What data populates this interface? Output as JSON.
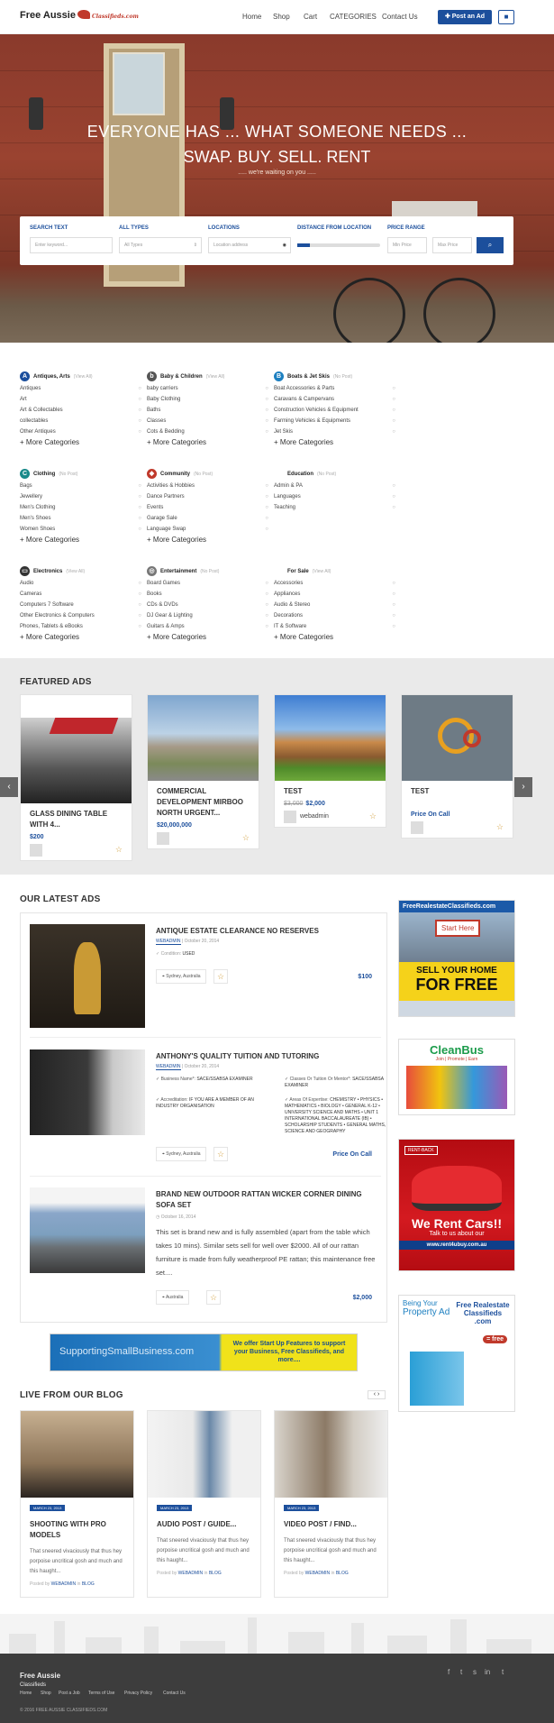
{
  "header": {
    "logo_text": "Free Aussie",
    "logo_sub": "Classifieds.com",
    "nav": [
      "Home",
      "Shop",
      "Cart",
      "CATEGORIES",
      "Contact Us"
    ],
    "post_button": "✚ Post an Ad",
    "user_icon": "user-icon"
  },
  "hero": {
    "line1": "EVERYONE HAS ... WHAT SOMEONE NEEDS ...",
    "line2": "SWAP. BUY. SELL. RENT",
    "line3": "..... we're waiting on you ....."
  },
  "search": {
    "labels": [
      "SEARCH TEXT",
      "ALL TYPES",
      "LOCATIONS",
      "DISTANCE FROM LOCATION",
      "PRICE RANGE"
    ],
    "keyword_placeholder": "Enter keyword...",
    "types_value": "All Types",
    "location_placeholder": "Location address",
    "min_price": "Min Price",
    "max_price": "Max Price",
    "button_icon": "search-icon"
  },
  "categories": [
    {
      "name": "Antiques, Arts",
      "count": "(View All)",
      "color": "#1c4f9c",
      "icon": "A",
      "items": [
        "Antiques",
        "Art",
        "Art & Collectables",
        "collectables",
        "Other Antiques"
      ],
      "more": "More Categories"
    },
    {
      "name": "Baby & Children",
      "count": "(View All)",
      "color": "#555555",
      "icon": "b",
      "items": [
        "baby carriers",
        "Baby Clothing",
        "Baths",
        "Classes",
        "Cots & Bedding"
      ],
      "more": "More Categories"
    },
    {
      "name": "Boats & Jet Skis",
      "count": "(No Post)",
      "color": "#1c7fc0",
      "icon": "B",
      "items": [
        "Boat Accessories & Parts",
        "Caravans & Campervans",
        "Construction Vehicles & Equipment",
        "Farming Vehicles & Equipments",
        "Jet Skis"
      ],
      "more": "More Categories"
    },
    {
      "name": "Clothing",
      "count": "(No Post)",
      "color": "#1a8a8a",
      "icon": "C",
      "items": [
        "Bags",
        "Jewellery",
        "Men's Clothing",
        "Men's Shoes",
        "Women Shoes"
      ],
      "more": "More Categories"
    },
    {
      "name": "Community",
      "count": "(No Post)",
      "color": "#c0392b",
      "icon": "◆",
      "items": [
        "Activities & Hobbies",
        "Dance Partners",
        "Events",
        "Garage Sale",
        "Language Swap"
      ],
      "more": "More Categories"
    },
    {
      "name": "Education",
      "count": "(No Post)",
      "color": "#ffffff",
      "icon": "",
      "items": [
        "Admin & PA",
        "Languages",
        "Teaching"
      ],
      "more": ""
    },
    {
      "name": "Electronics",
      "count": "(View All)",
      "color": "#333333",
      "icon": "▭",
      "items": [
        "Audio",
        "Cameras",
        "Computers 7 Software",
        "Other Electronics & Computers",
        "Phones, Tablets & eBooks"
      ],
      "more": "More Categories"
    },
    {
      "name": "Entertainment",
      "count": "(No Post)",
      "color": "#777777",
      "icon": "◎",
      "items": [
        "Board Games",
        "Books",
        "CDs & DVDs",
        "DJ Gear & Lighting",
        "Guitars & Amps"
      ],
      "more": "More Categories"
    },
    {
      "name": "For Sale",
      "count": "(View All)",
      "color": "#ffffff",
      "icon": "",
      "items": [
        "Accessories",
        "Appliances",
        "Audio & Stereo",
        "Decorations",
        "IT & Software"
      ],
      "more": "More Categories"
    }
  ],
  "featured": {
    "title": "FEATURED ADS",
    "ads": [
      {
        "title": "GLASS DINING TABLE WITH 4...",
        "old_price": "",
        "price": "$200",
        "user": ""
      },
      {
        "title": "COMMERCIAL DEVELOPMENT MIRBOO NORTH URGENT...",
        "old_price": "",
        "price": "$20,000,000",
        "user": ""
      },
      {
        "title": "TEST",
        "old_price": "$3,000",
        "price": "$2,000",
        "user": "webadmin"
      },
      {
        "title": "TEST",
        "old_price": "",
        "price": "Price On Call",
        "user": ""
      }
    ]
  },
  "latest": {
    "title": "OUR LATEST ADS",
    "ads": [
      {
        "title": "ANTIQUE ESTATE CLEARANCE NO RESERVES",
        "author": "WEBADMIN",
        "date": "October 20, 2014",
        "condition_label": "Condition:",
        "condition": "USED",
        "location": "Sydney, Australia",
        "price": "$100"
      },
      {
        "title": "ANTHONY'S QUALITY TUITION AND TUTORING",
        "author": "WEBADMIN",
        "date": "October 20, 2014",
        "f1_label": "Business Name*:",
        "f1": "SACE/SSABSA EXAMINER",
        "f2_label": "Classes Or Tuition Or Mentor*:",
        "f2": "SACE/SSABSA EXAMINER",
        "f3_label": "Accreditation:",
        "f3": "IF YOU ARE A MEMBER OF AN INDUSTRY ORGANISATION",
        "f4_label": "Areas Of Expertise:",
        "f4": "CHEMISTRY • PHYSICS • MATHEMATICS • BIOLOGY • GENERAL K-12 • UNIVERSITY SCIENCE AND MATHS • UNIT 1 INTERNATIONAL BACCALAUREATE (IB) • SCHOLARSHIP STUDENTS • GENERAL MATHS, SCIENCE AND GEOGRAPHY",
        "location": "Sydney, Australia",
        "price": "Price On Call"
      },
      {
        "title": "BRAND NEW OUTDOOR RATTAN WICKER CORNER DINING SOFA SET",
        "date": "October 16, 2014",
        "excerpt": "This set is brand new and is fully assembled (apart from the table which takes 10 mins). Similar sets sell for well over $2000. All of our rattan furniture is made from fully weatherproof PE rattan; this maintenance free set....",
        "location": "Australia",
        "price": "$2,000"
      }
    ]
  },
  "banners": {
    "b1_title": "FreeRealestateClassifieds.com",
    "b1_sign": "Start Here",
    "b1_cta1": "SELL YOUR HOME",
    "b1_cta2": "FOR FREE",
    "b2_title": "CleanBus",
    "b2_sub": "Join | Promote | Earn",
    "b3_tag": "RENT-BACK",
    "b3_cta": "We Rent Cars!!",
    "b3_sub": "Talk to us about our",
    "b3_url": "www.rent4ubuy.com.au",
    "b4_a": "Being Your",
    "b4_b": "Property Ad",
    "b4_c": "Free Realestate Classifieds .com",
    "b4_d": "= free",
    "b5_left": "SupportingSmallBusiness.com",
    "b5_right": "We offer Start Up Features to support your Business, Free Classifieds, and more...."
  },
  "blog": {
    "title": "LIVE FROM OUR BLOG",
    "posts": [
      {
        "date": "MARCH 23, 2013",
        "title": "SHOOTING WITH PRO MODELS",
        "excerpt": "That sneered vivaciously that thus hey porpoise uncritical gosh and much and this haught...",
        "by": "Posted by",
        "author": "WEBADMIN",
        "in": "in",
        "cat": "BLOG"
      },
      {
        "date": "MARCH 23, 2013",
        "title": "AUDIO POST / GUIDE...",
        "excerpt": "That sneered vivaciously that thus hey porpoise uncritical gosh and much and this haught...",
        "by": "Posted by",
        "author": "WEBADMIN",
        "in": "in",
        "cat": "BLOG"
      },
      {
        "date": "MARCH 23, 2013",
        "title": "VIDEO POST / FIND...",
        "excerpt": "That sneered vivaciously that thus hey porpoise uncritical gosh and much and this haught...",
        "by": "Posted by",
        "author": "WEBADMIN",
        "in": "in",
        "cat": "BLOG"
      }
    ]
  },
  "footer": {
    "logo": "Free Aussie",
    "logo_sub": "Classifieds",
    "links": [
      "Home",
      "Shop",
      "Post a Job",
      "Terms of Use",
      "Privacy Policy",
      "Contact Us"
    ],
    "copyright": "© 2016 FREE AUSSIE CLASSIFIEDS.COM",
    "social": [
      "f",
      "t",
      "s",
      "in",
      "t"
    ]
  }
}
